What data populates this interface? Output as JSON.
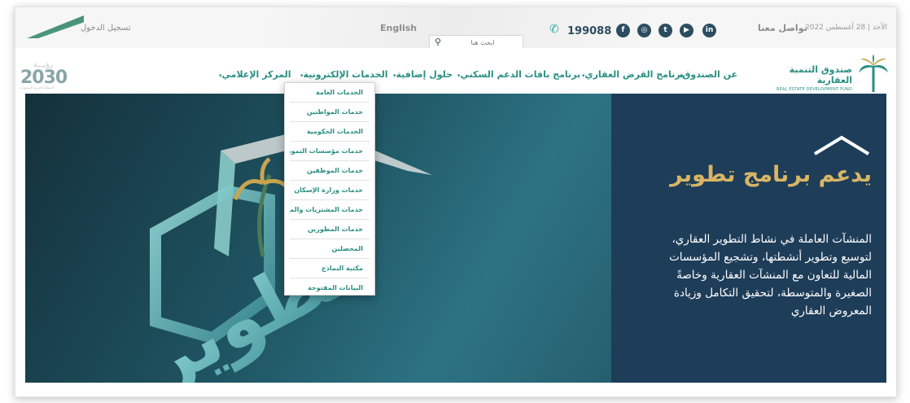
{
  "topbar": {
    "login": "تسجيل الدخول",
    "language": "English",
    "search_placeholder": "ابحث هنا",
    "phone": "199088",
    "social": [
      {
        "icon": "linkedin-icon",
        "glyph": "in"
      },
      {
        "icon": "youtube-icon",
        "glyph": "▶"
      },
      {
        "icon": "twitter-icon",
        "glyph": "t"
      },
      {
        "icon": "instagram-icon",
        "glyph": "◎"
      },
      {
        "icon": "facebook-icon",
        "glyph": "f"
      }
    ],
    "contact": "تواصل معنا",
    "date": "الأحد | 28 أغسطس 2022"
  },
  "vision": {
    "top": "رؤيـــة",
    "year": "2030",
    "sub": "المملكة العربية السعودية"
  },
  "fund": {
    "name_ar": "صندوق التنمية العقارية",
    "name_en": "REAL ESTATE DEVELOPMENT FUND"
  },
  "nav": {
    "items": [
      {
        "label": "عن الصندوق"
      },
      {
        "label": "برنامج القرض العقاري"
      },
      {
        "label": "برنامج باقات الدعم السكني"
      },
      {
        "label": "حلول إضافية"
      },
      {
        "label": "الخدمات الإلكترونية"
      },
      {
        "label": "المركز الإعلامي"
      }
    ]
  },
  "dropdown": {
    "items": [
      "الخدمات العامة",
      "خدمات المواطنين",
      "الخدمات الحكومية",
      "خدمات مؤسسات التمويل",
      "خدمات الموظفين",
      "خدمات وزارة الإسكان",
      "خدمات المشتريات والموردين",
      "خدمات المطورين",
      "المحصلين",
      "مكتبة النماذج",
      "البيانات المفتوحة"
    ]
  },
  "hero": {
    "title": "يدعم برنامج تطوير",
    "body": "المنشآت العاملة في نشاط التطوير العقاري، لتوسيع وتطوير أنشطتها، وتشجيع المؤسسات المالية للتعاون مع المنشآت العقارية وخاصةً الصغيرة والمتوسطة، لتحقيق التكامل وزيادة المعروض العقاري",
    "image_text": "تطوير"
  },
  "colors": {
    "brand_green": "#2a8f82",
    "navy": "#1e3d59",
    "gold": "#d8b565"
  }
}
